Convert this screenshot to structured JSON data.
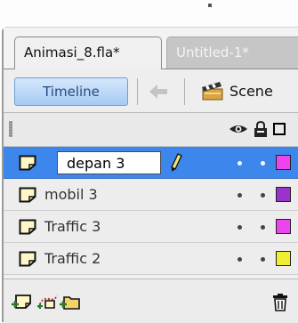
{
  "tabs": [
    {
      "label": "Animasi_8.fla*",
      "active": true
    },
    {
      "label": "Untitled-1*",
      "active": false
    }
  ],
  "toolbar": {
    "timeline_label": "Timeline",
    "back_icon": "back-arrow-icon",
    "scene_icon": "clapperboard-icon",
    "scene_label": "Scene"
  },
  "header_icons": [
    "eye-icon",
    "lock-icon",
    "outline-icon"
  ],
  "layers": [
    {
      "name": "depan 3",
      "selected": true,
      "editing": true,
      "color": "#ee44ee"
    },
    {
      "name": "mobil 3",
      "selected": false,
      "editing": false,
      "color": "#9a33cc"
    },
    {
      "name": "Traffic 3",
      "selected": false,
      "editing": false,
      "color": "#ee44ee"
    },
    {
      "name": "Traffic 2",
      "selected": false,
      "editing": false,
      "color": "#eeee33"
    }
  ],
  "footer_icons": [
    "new-layer-icon",
    "motion-guide-icon",
    "new-folder-icon",
    "trash-icon"
  ]
}
